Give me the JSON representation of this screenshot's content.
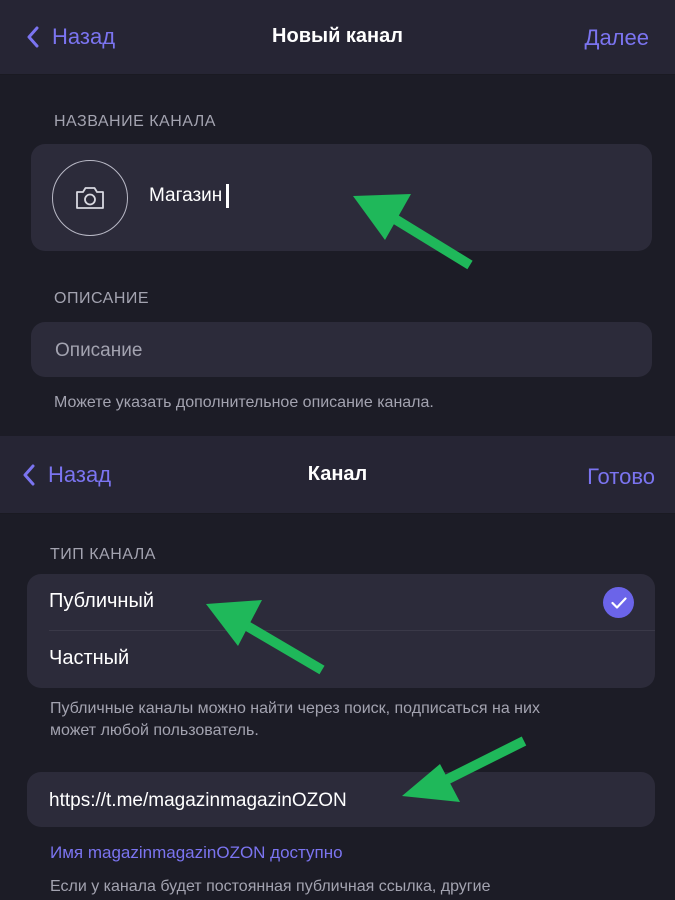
{
  "screen1": {
    "nav": {
      "back_label": "Назад",
      "title": "Новый канал",
      "action_label": "Далее"
    },
    "name_section": {
      "header": "НАЗВАНИЕ КАНАЛА",
      "input_value": "Магазин"
    },
    "description_section": {
      "header": "ОПИСАНИЕ",
      "placeholder": "Описание",
      "hint": "Можете указать дополнительное описание канала."
    }
  },
  "screen2": {
    "nav": {
      "back_label": "Назад",
      "title": "Канал",
      "action_label": "Готово"
    },
    "type_section": {
      "header": "ТИП КАНАЛА",
      "options": [
        {
          "label": "Публичный",
          "selected": true
        },
        {
          "label": "Частный",
          "selected": false
        }
      ],
      "hint_line1": "Публичные каналы можно найти через поиск, подписаться на них",
      "hint_line2": "может любой пользователь."
    },
    "link_section": {
      "link_value": "https://t.me/magazinmagazinOZON",
      "availability": "Имя magazinmagazinOZON доступно",
      "hint": "Если у канала будет постоянная публичная ссылка, другие"
    }
  },
  "colors": {
    "accent": "#7b74f0",
    "annotation_arrow": "#1fb85a"
  }
}
